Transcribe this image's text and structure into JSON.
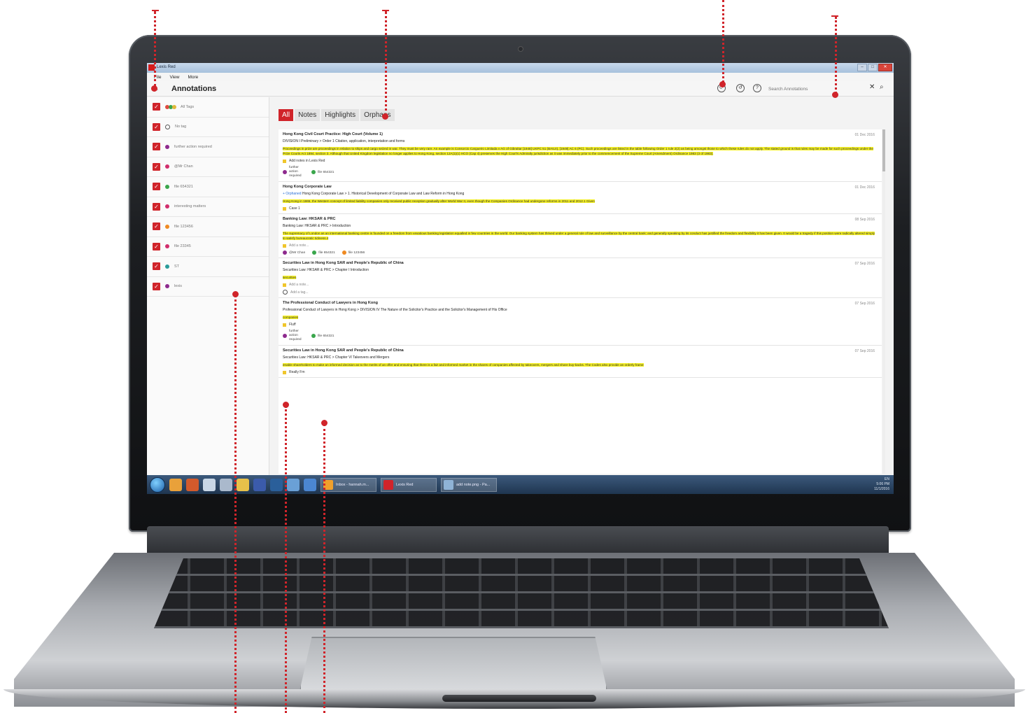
{
  "window": {
    "title": "Lexis Red",
    "controls": [
      "–",
      "□",
      "✕"
    ]
  },
  "menu": [
    "File",
    "View",
    "More"
  ],
  "header": {
    "back_icon": "←",
    "title": "Annotations",
    "search_placeholder": "Search Annotations",
    "icons": [
      "sync-icon",
      "history-icon",
      "help-icon",
      "clear-icon",
      "search-icon"
    ]
  },
  "sidebar": {
    "tags": [
      {
        "label": "All Tags",
        "multi": true,
        "colors": [
          "#e04a3f",
          "#3aa64c",
          "#e0b83a"
        ]
      },
      {
        "label": "No tag",
        "empty": true
      },
      {
        "label": "further action required",
        "color": "#8e2a8e"
      },
      {
        "label": "@Mr Chan",
        "color": "#d12e6c"
      },
      {
        "label": "file 654321",
        "color": "#3aa64c"
      },
      {
        "label": "interesting matters",
        "color": "#d12e6c"
      },
      {
        "label": "file 123456",
        "color": "#ef8a22"
      },
      {
        "label": "file 23345",
        "color": "#d12e6c"
      },
      {
        "label": "ST",
        "color": "#2a9c9a"
      },
      {
        "label": "lexis",
        "color": "#8e2a8e"
      }
    ]
  },
  "filter_tabs": [
    "All",
    "Notes",
    "Highlights",
    "Orphans"
  ],
  "annotations": [
    {
      "title": "Hong Kong Civil Court Practice: High Court (Volume 1)",
      "date": "01 Dec 2016",
      "path": "DIVISION I Preliminary > Order 1 Citation, application, interpretation and forms",
      "orphan": "",
      "highlight": "Proceedings in prize are proceedings in relation to ships and cargo seized in war. They must be very rare. An example is Consorcio Cargueiro Limitada v AG of Gibraltar [1948] UKPC 51 (BAILII), [1949] AC 6 (PC). Such proceedings are listed in the table following Order 1 rule 2(2) as being amongst those to which these rules do not apply. The stated ground is that rules may be made for such proceedings under the Prize Courts Act 1894, section 3. Although that United Kingdom legislation no longer applies to Hong Kong, section 12A(1)(c) HCO (Cap 4) preserves the High Court's Admiralty jurisdiction as it was immediately prior to the commencement of the Supreme Court (Amendment) Ordinance 1983 (3 of 1983).",
      "note": "Add notes in Lexis Red",
      "tags": [
        {
          "label": "further action required",
          "color": "#8e2a8e"
        },
        {
          "label": "file 654321",
          "color": "#3aa64c"
        }
      ]
    },
    {
      "title": "Hong Kong Corporate Law",
      "date": "01 Dec 2016",
      "path": "Hong Kong Corporate Law > 1. Historical Development of Corporate Law and Law Reform in Hong Kong",
      "orphan": "+ Orphaned",
      "highlight": "Hong Kong in 1865, the Western concept of limited liability companies only received public reception gradually after World War II, even though the Companies Ordinance had undergone reforms in 2011 and 2012.1 Given",
      "note": "Case 1",
      "tags": []
    },
    {
      "title": "Banking Law: HKSAR & PRC",
      "date": "08 Sep 2016",
      "path": "Banking Law: HKSAR & PRC > Introduction",
      "orphan": "",
      "highlight": "The supremacy of London as an international banking centre is founded on a freedom from vexatious banking legislation equalled in few countries in the world. Our banking system has thrived under a general rule of law and surveillance by the central bank; and generally speaking by its conduct has justified the freedom and flexibility it has been given. It would be a tragedy if this position were radically altered simply to satisfy bureaucratic tidiness.4",
      "note": "Add a note...",
      "tags": [
        {
          "label": "@Mr Chan",
          "color": "#8e2a8e"
        },
        {
          "label": "file 654321",
          "color": "#3aa64c"
        },
        {
          "label": "file 123456",
          "color": "#ef8a22"
        }
      ]
    },
    {
      "title": "Securities Law in Hong Kong SAR and People's Republic of China",
      "date": "07 Sep 2016",
      "path": "Securities Law: HKSAR & PRC > Chapter I Introduction",
      "orphan": "",
      "highlight": "securities",
      "note": "Add a note...",
      "add_tag": "Add a tag...",
      "tags": []
    },
    {
      "title": "The Professional Conduct of Lawyers in Hong Kong",
      "date": "07 Sep 2016",
      "path": "Professional Conduct of Lawyers in Hong Kong > DIVISION IV The Nature of the Solicitor's Practice and the Solicitor's Management of His Office",
      "orphan": "",
      "highlight": "companies",
      "note": "Fluff",
      "tags": [
        {
          "label": "further action required",
          "color": "#8e2a8e"
        },
        {
          "label": "file 654321",
          "color": "#3aa64c"
        }
      ]
    },
    {
      "title": "Securities Law in Hong Kong SAR and People's Republic of China",
      "date": "07 Sep 2016",
      "path": "Securities Law: HKSAR & PRC > Chapter VI Takeovers and Mergers",
      "orphan": "",
      "highlight": "enable shareholders to make an informed decision as to the merits of an offer and ensuring that there is a fair and informed market in the shares of companies affected by takeovers, mergers and share buy-backs. The Codes also provide an orderly frame",
      "note": "Really Fm",
      "tags": []
    }
  ],
  "taskbar": {
    "tasks": [
      "Inbox - hannah.m...",
      "Lexis Red",
      "add note.png - Pa..."
    ],
    "tray_time": "5:06 PM",
    "tray_date": "11/1/2016",
    "tray_lang": "EN"
  },
  "colors": {
    "accent": "#d0242a",
    "highlight": "#f4f025"
  }
}
